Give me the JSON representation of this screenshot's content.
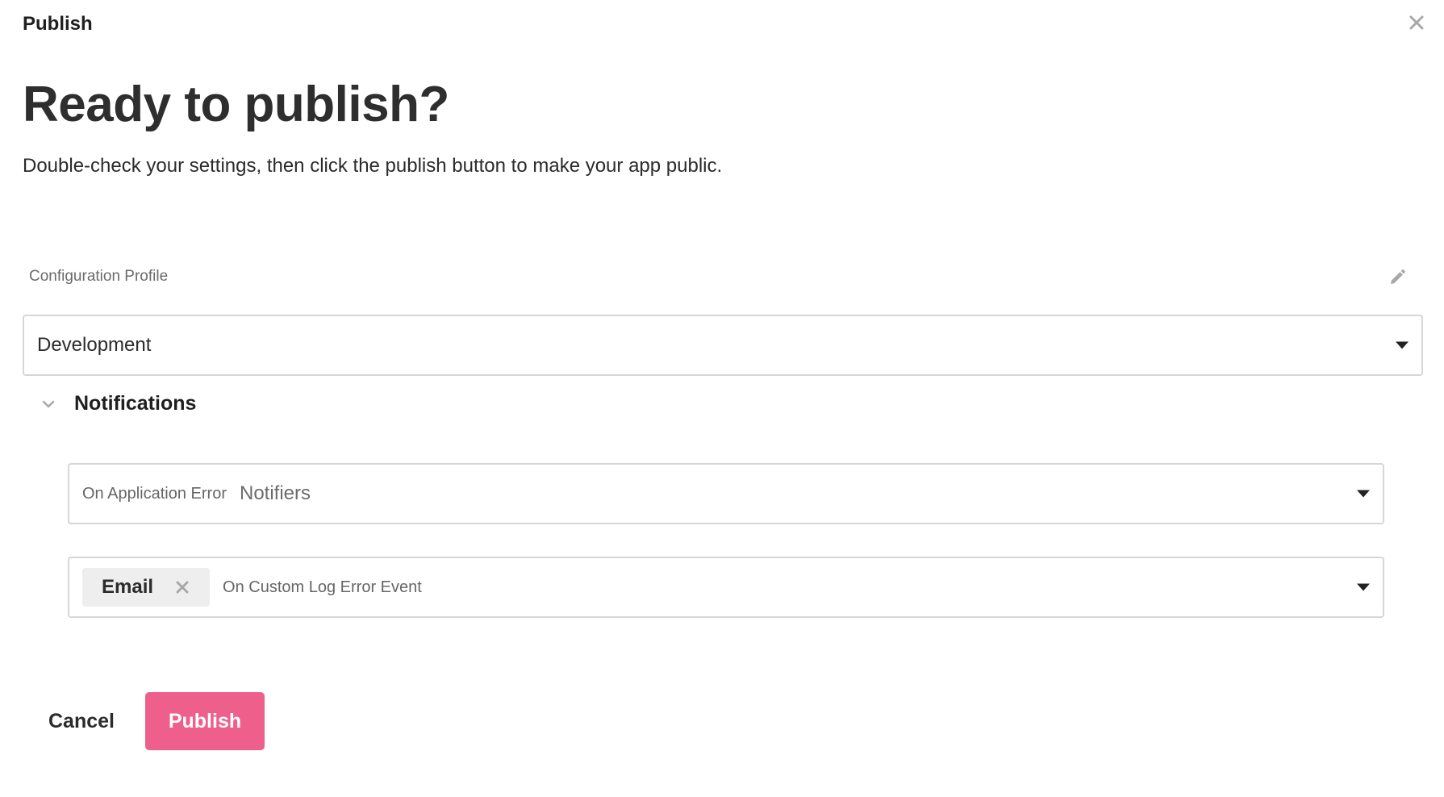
{
  "modal": {
    "title": "Publish"
  },
  "content": {
    "heading": "Ready to publish?",
    "subtitle": "Double-check your settings, then click the publish button to make your app public."
  },
  "config_profile": {
    "label": "Configuration Profile",
    "selected": "Development"
  },
  "notifications": {
    "section_label": "Notifications",
    "expanded": true,
    "on_application_error": {
      "label": "On Application Error",
      "placeholder": "Notifiers"
    },
    "on_custom_log_error_event": {
      "label": "On Custom Log Error Event",
      "chips": [
        "Email"
      ]
    }
  },
  "actions": {
    "cancel_label": "Cancel",
    "publish_label": "Publish"
  },
  "colors": {
    "primary": "#ee5f8b",
    "border": "#d6d6d6",
    "chip_bg": "#eeeeee",
    "icon_gray": "#a8a8a8"
  },
  "icons": {
    "close": "close-icon",
    "edit": "pencil-icon",
    "caret": "caret-down-icon",
    "chevron": "chevron-down-icon",
    "chip_remove": "remove-icon"
  }
}
